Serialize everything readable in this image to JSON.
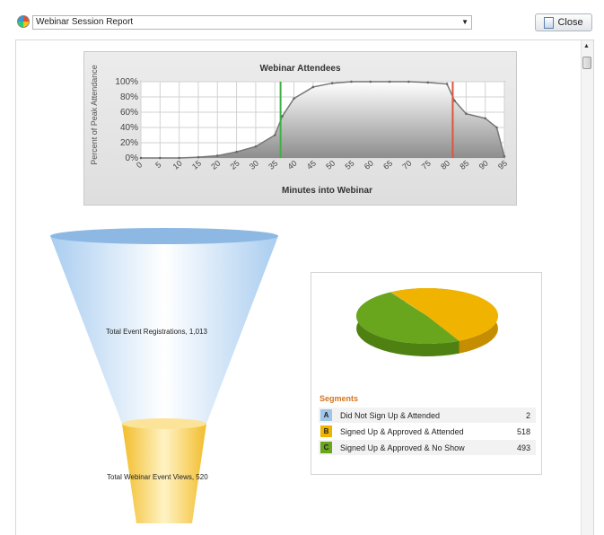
{
  "header": {
    "report_select_value": "Webinar Session Report",
    "close_label": "Close"
  },
  "colors": {
    "green_marker": "#3cb043",
    "red_marker": "#e0553a",
    "segment_a": "#9fc5e8",
    "segment_b": "#f0b400",
    "segment_c": "#6aa51e",
    "segments_title": "#d4751e"
  },
  "chart_data": [
    {
      "type": "area",
      "title": "Webinar Attendees",
      "xlabel": "Minutes into Webinar",
      "ylabel": "Percent of Peak Attendance",
      "x": [
        0,
        5,
        10,
        15,
        20,
        25,
        30,
        35,
        37,
        40,
        45,
        50,
        55,
        60,
        65,
        70,
        75,
        80,
        82,
        85,
        90,
        93,
        95
      ],
      "y": [
        0,
        0,
        0,
        1,
        3,
        8,
        15,
        30,
        55,
        78,
        93,
        98,
        100,
        100,
        100,
        100,
        99,
        97,
        75,
        58,
        52,
        40,
        2
      ],
      "xlim": [
        0,
        95
      ],
      "ylim": [
        0,
        100
      ],
      "x_ticks": [
        0,
        5,
        10,
        15,
        20,
        25,
        30,
        35,
        40,
        45,
        50,
        55,
        60,
        65,
        70,
        75,
        80,
        85,
        90,
        95
      ],
      "y_ticks": [
        "0%",
        "20%",
        "40%",
        "60%",
        "80%",
        "100%"
      ],
      "y_tick_values": [
        0,
        20,
        40,
        60,
        80,
        100
      ],
      "markers": [
        {
          "x": 36.5,
          "color": "#3cb043"
        },
        {
          "x": 81.5,
          "color": "#e0553a"
        }
      ],
      "grid": true
    },
    {
      "type": "funnel",
      "stages": [
        {
          "label": "Total Event Registrations, 1,013",
          "value": 1013
        },
        {
          "label": "Total Webinar Event Views, 520",
          "value": 520
        }
      ]
    },
    {
      "type": "pie",
      "legend_title": "Segments",
      "slices": [
        {
          "letter": "A",
          "label": "Did Not Sign Up & Attended",
          "value": 2,
          "color": "#9fc5e8"
        },
        {
          "letter": "B",
          "label": "Signed Up & Approved & Attended",
          "value": 518,
          "color": "#f0b400"
        },
        {
          "letter": "C",
          "label": "Signed Up & Approved & No Show",
          "value": 493,
          "color": "#6aa51e"
        }
      ]
    }
  ]
}
